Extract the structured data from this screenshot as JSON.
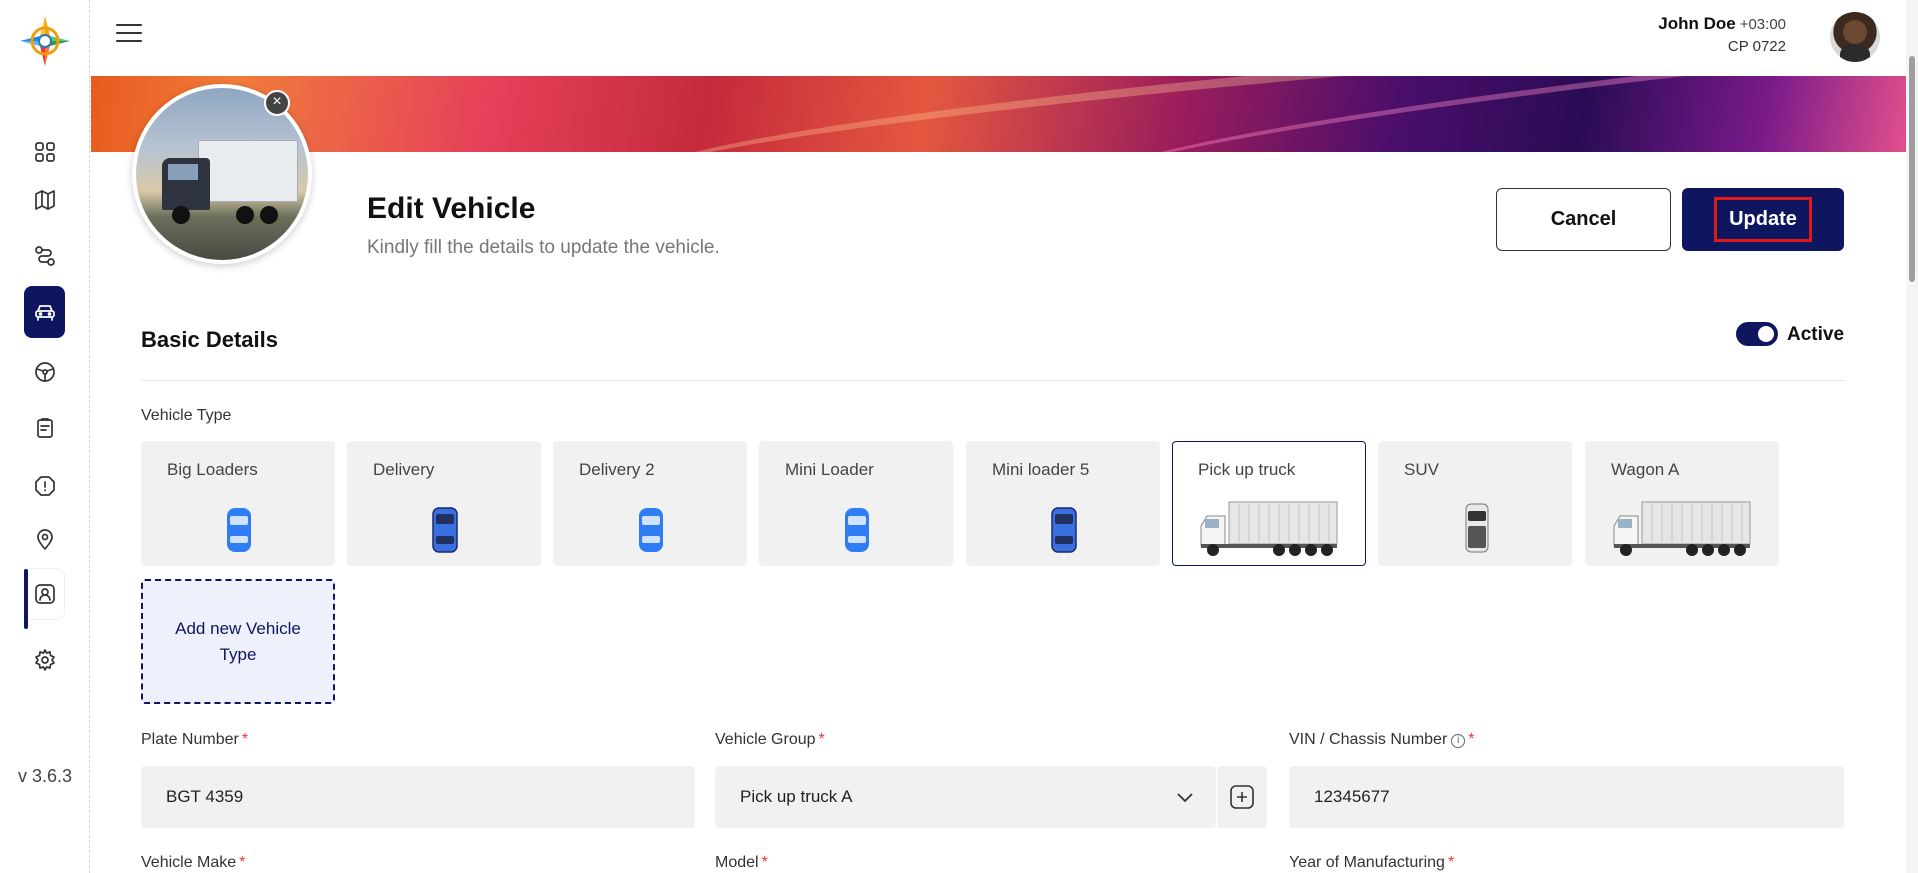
{
  "sidebar": {
    "version": "v 3.6.3",
    "items": [
      {
        "name": "dashboard"
      },
      {
        "name": "map"
      },
      {
        "name": "routes"
      },
      {
        "name": "vehicles"
      },
      {
        "name": "tires"
      },
      {
        "name": "tasks"
      },
      {
        "name": "alerts"
      },
      {
        "name": "locations"
      },
      {
        "name": "drivers"
      },
      {
        "name": "settings"
      }
    ]
  },
  "header": {
    "user_name": "John Doe",
    "timezone": "+03:00",
    "user_code": "CP 0722"
  },
  "page": {
    "title": "Edit Vehicle",
    "subtitle": "Kindly fill the details to update the vehicle.",
    "cancel_label": "Cancel",
    "update_label": "Update",
    "remove_photo_icon": "×"
  },
  "basic": {
    "title": "Basic Details",
    "status_label": "Active",
    "vehicle_type_label": "Vehicle Type",
    "vehicle_types": [
      {
        "name": "Big Loaders",
        "icon": "car"
      },
      {
        "name": "Delivery",
        "icon": "car"
      },
      {
        "name": "Delivery 2",
        "icon": "car"
      },
      {
        "name": "Mini Loader",
        "icon": "car"
      },
      {
        "name": "Mini loader 5",
        "icon": "car"
      },
      {
        "name": "Pick up truck",
        "icon": "truck",
        "selected": true
      },
      {
        "name": "SUV",
        "icon": "suv"
      },
      {
        "name": "Wagon A",
        "icon": "truck"
      }
    ],
    "add_type_label": "Add new Vehicle Type",
    "plate_label": "Plate Number",
    "plate_value": "BGT 4359",
    "group_label": "Vehicle Group",
    "group_value": "Pick up truck A",
    "vin_label": "VIN / Chassis Number",
    "vin_value": "12345677",
    "make_label": "Vehicle Make",
    "model_label": "Model",
    "year_label": "Year of Manufacturing",
    "required_mark": "*",
    "info_mark": "i"
  },
  "colors": {
    "primary": "#0f1660",
    "required": "#e53935",
    "highlight": "#e01818"
  }
}
